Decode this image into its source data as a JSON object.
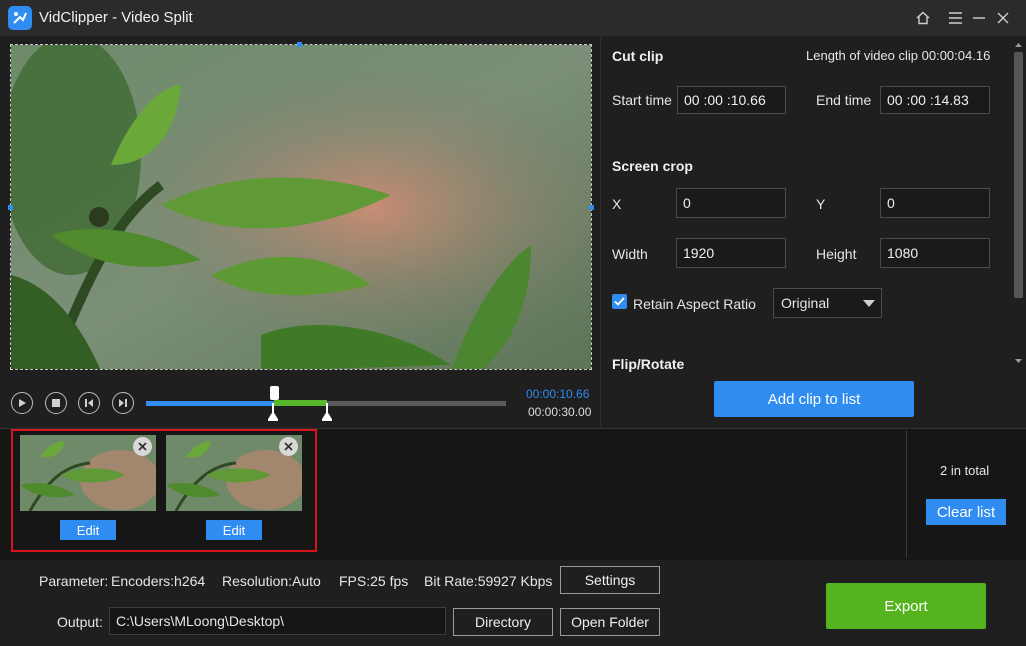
{
  "window": {
    "title": "VidClipper - Video Split",
    "icons": [
      "home-icon",
      "menu-icon",
      "minimize-icon",
      "close-icon"
    ]
  },
  "player": {
    "current_time": "00:00:10.66",
    "total_time": "00:00:30.00",
    "played_fraction": 0.355,
    "selection_start_fraction": 0.355,
    "selection_end_fraction": 0.494
  },
  "cut_clip": {
    "title": "Cut clip",
    "length_text": "Length of video clip 00:00:04.16",
    "start_label": "Start time",
    "start_value": "00 :00 :10.66",
    "end_label": "End time",
    "end_value": "00 :00 :14.83"
  },
  "screen_crop": {
    "title": "Screen crop",
    "x_label": "X",
    "x_value": "0",
    "y_label": "Y",
    "y_value": "0",
    "width_label": "Width",
    "width_value": "1920",
    "height_label": "Height",
    "height_value": "1080",
    "retain_label": "Retain Aspect Ratio",
    "retain_checked": true,
    "ratio_value": "Original"
  },
  "flip_rotate": {
    "title": "Flip/Rotate"
  },
  "add_clip_label": "Add clip to list",
  "clips": {
    "count_text": "2 in total",
    "edit_label": "Edit",
    "clear_label": "Clear list"
  },
  "parameter": {
    "label": "Parameter:",
    "encoders": "Encoders:h264",
    "resolution": "Resolution:Auto",
    "fps": "FPS:25 fps",
    "bitrate": "Bit Rate:59927 Kbps",
    "settings_label": "Settings"
  },
  "output": {
    "label": "Output:",
    "path": "C:\\Users\\MLoong\\Desktop\\",
    "directory_label": "Directory",
    "open_folder_label": "Open Folder"
  },
  "export_label": "Export",
  "colors": {
    "accent": "#2f8cf0",
    "selection": "#58b82b",
    "export": "#55b31e",
    "highlight": "#d9141f"
  }
}
